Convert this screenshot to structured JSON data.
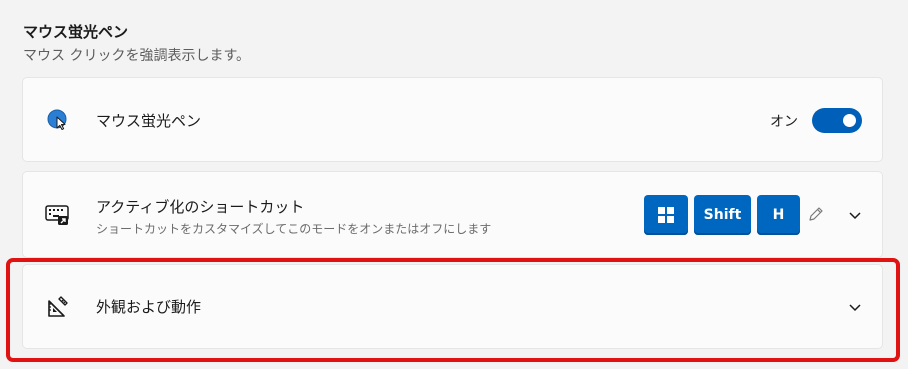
{
  "section": {
    "title": "マウス蛍光ペン",
    "description": "マウス クリックを強調表示します。"
  },
  "enable_row": {
    "title": "マウス蛍光ペン",
    "toggle_state_label": "オン",
    "toggle_on": true,
    "icon": "mouse-highlighter-icon"
  },
  "shortcut_row": {
    "title": "アクティブ化のショートカット",
    "subtitle": "ショートカットをカスタマイズしてこのモードをオンまたはオフにします",
    "icon": "keyboard-shortcut-icon",
    "keys": [
      {
        "type": "windows-logo",
        "label": ""
      },
      {
        "type": "text",
        "label": "Shift"
      },
      {
        "type": "text",
        "label": "H"
      }
    ]
  },
  "appearance_row": {
    "title": "外観および動作",
    "icon": "appearance-ruler-icon"
  },
  "colors": {
    "accent": "#005fb8",
    "key_bg": "#0067c0",
    "highlight": "#e01212",
    "card_bg": "#fbfbfb",
    "page_bg": "#f3f3f3"
  }
}
